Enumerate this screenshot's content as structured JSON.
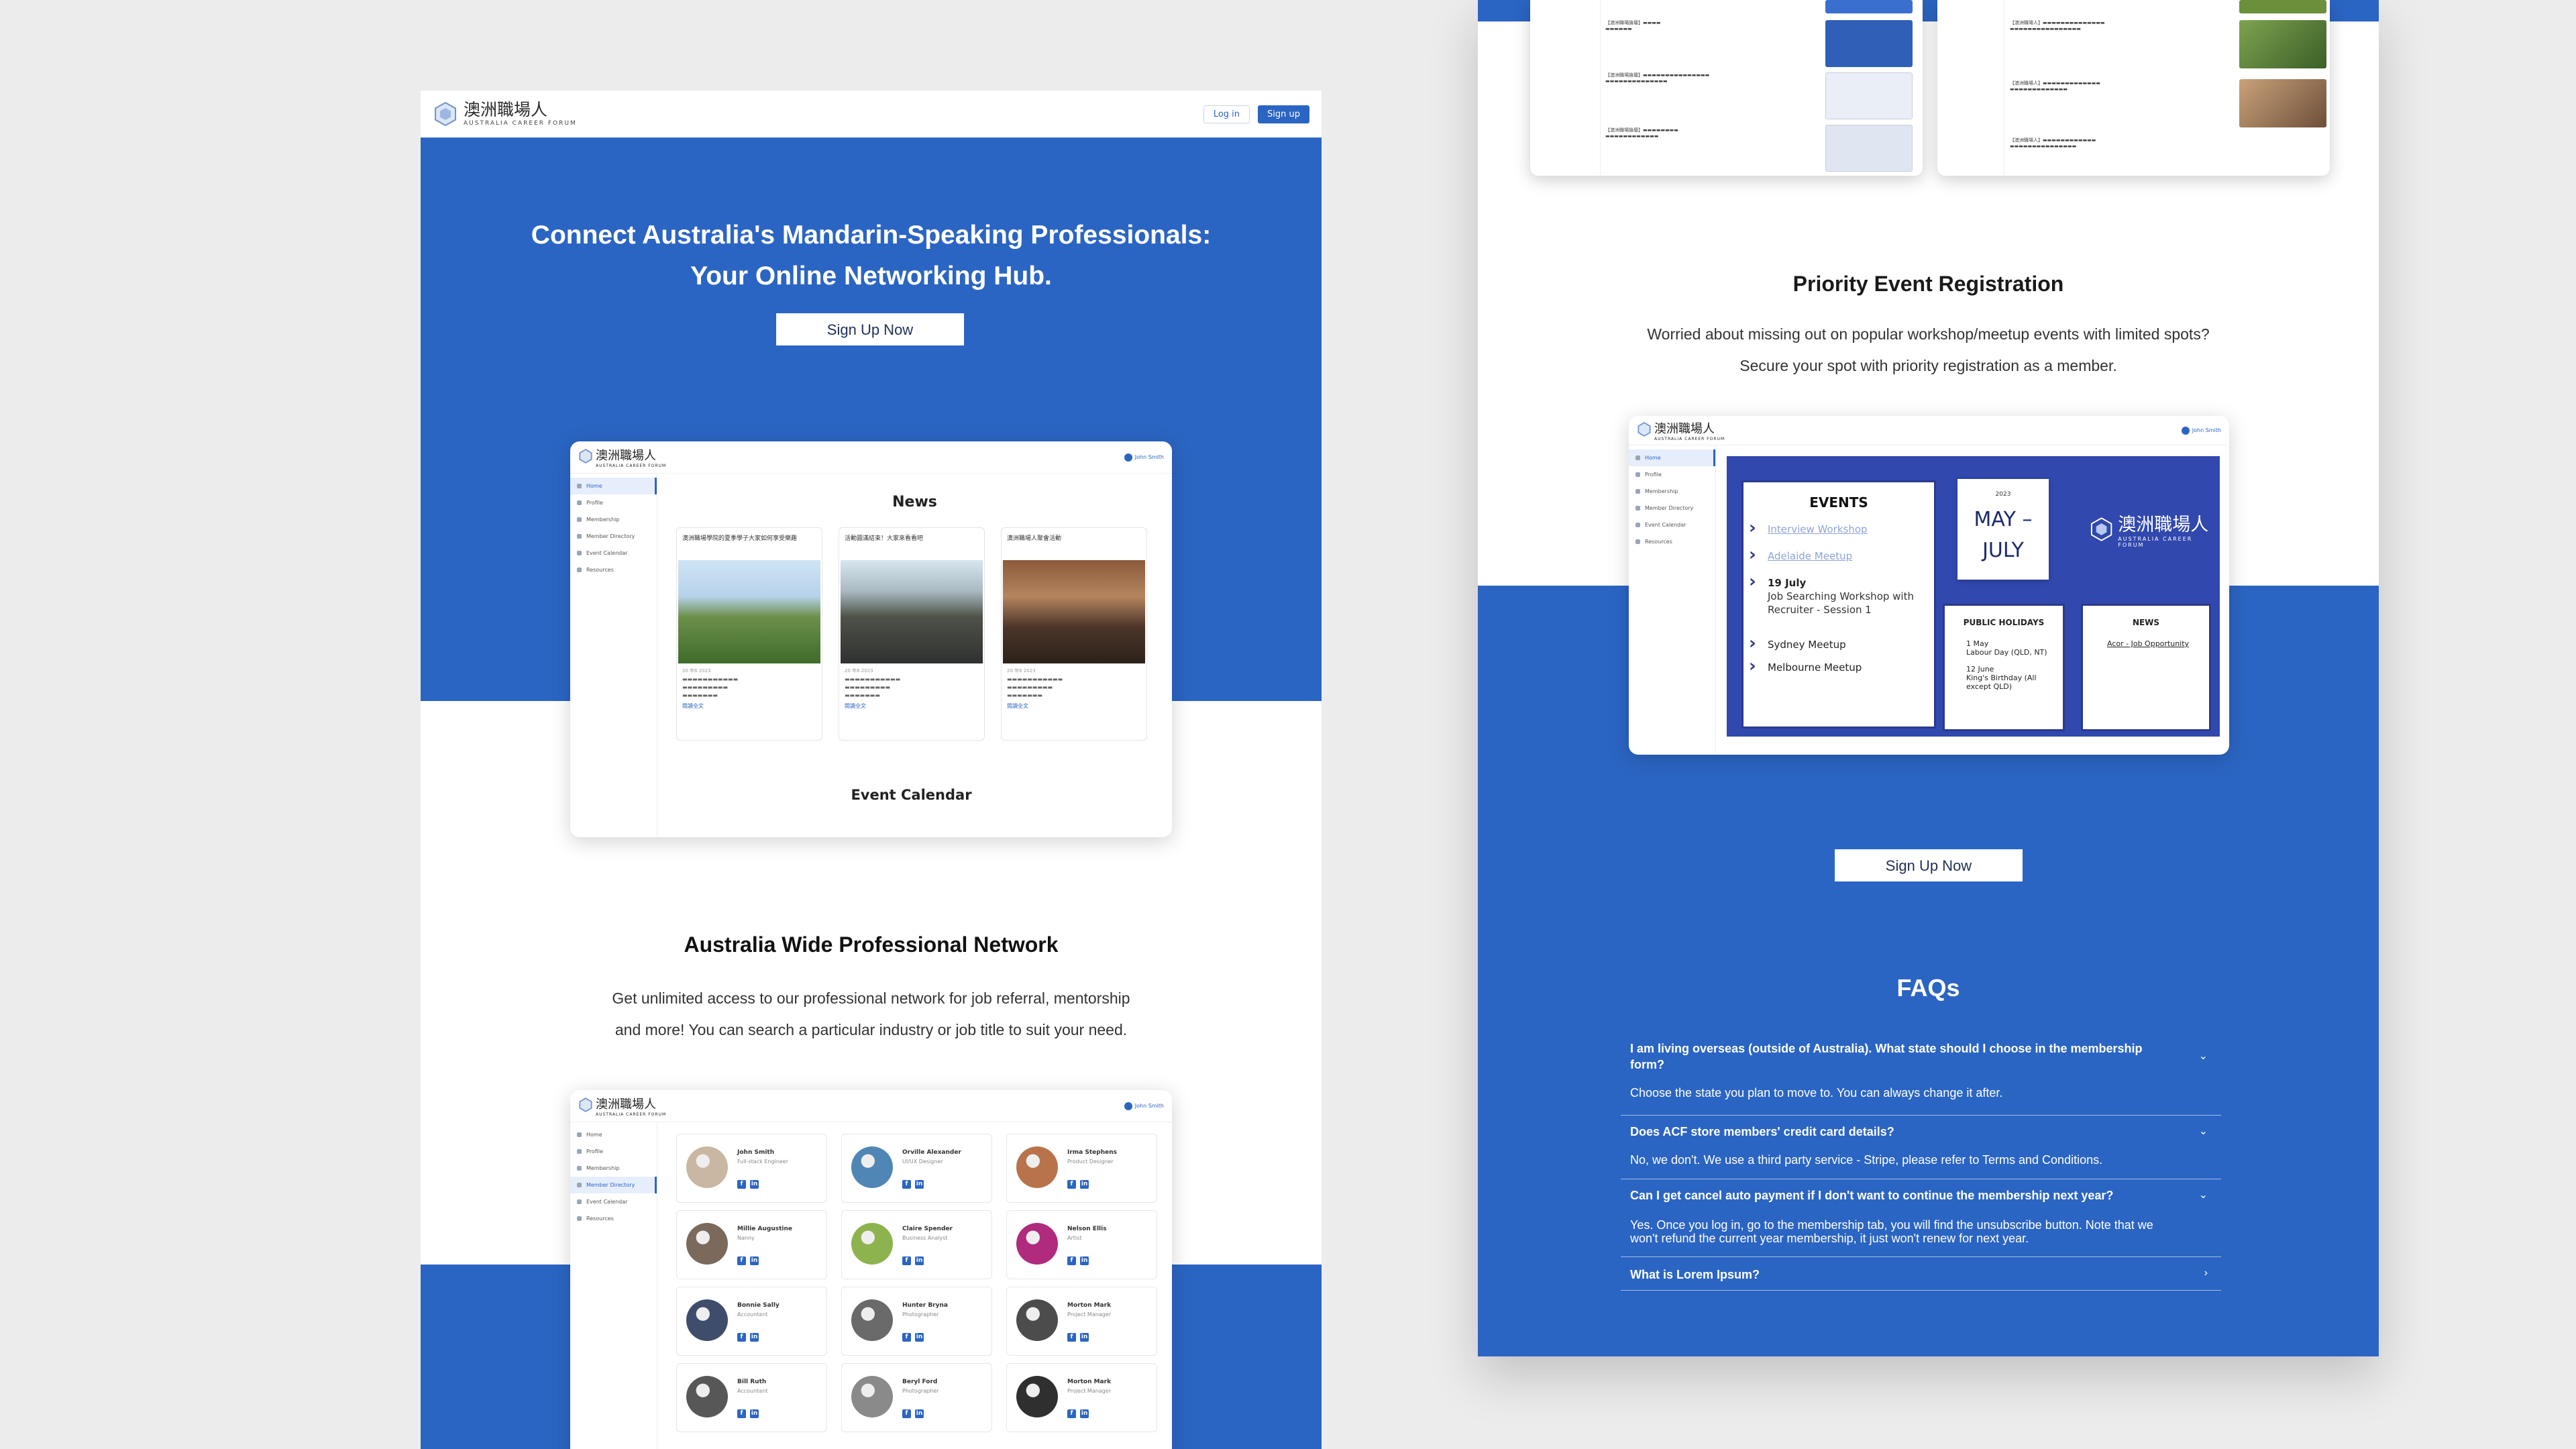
{
  "colors": {
    "brand_blue": "#2b65c3",
    "events_navy": "#3148ae",
    "background": "#ececec"
  },
  "brand": {
    "logo_cn": "澳洲職場人",
    "logo_en": "AUSTRALIA CAREER FORUM",
    "logo_icon": "hexagon-logo-icon"
  },
  "nav": {
    "login": "Log in",
    "signup": "Sign up"
  },
  "hero": {
    "line1": "Connect Australia's Mandarin-Speaking Professionals:",
    "line2": "Your Online Networking Hub.",
    "cta": "Sign Up Now"
  },
  "mock_app": {
    "user": "John Smith",
    "sidebar": [
      "Home",
      "Profile",
      "Membership",
      "Member Directory",
      "Event Calendar",
      "Resources"
    ],
    "news_heading": "News",
    "calendar_heading": "Event Calendar",
    "news": [
      {
        "title": "澳洲職場學院的夏季學子大家如何享受樂趣",
        "date": "20 年6 2023",
        "more": "閱讀全文"
      },
      {
        "title": "活動圓滿結束！大家來看看吧",
        "date": "20 年6 2023",
        "more": "閱讀全文"
      },
      {
        "title": "澳洲職場人聚會活動",
        "date": "20 年6 2023",
        "more": "閱讀全文"
      }
    ]
  },
  "network": {
    "title": "Australia Wide Professional Network",
    "text1": "Get unlimited access to our professional network for job referral, mentorship",
    "text2": "and more! You can search a particular industry or job title to suit your need.",
    "members": [
      {
        "name": "John Smith",
        "role": "Full-stack Engineer"
      },
      {
        "name": "Orville Alexander",
        "role": "UI/UX Designer"
      },
      {
        "name": "Irma Stephens",
        "role": "Product Designer"
      },
      {
        "name": "Millie Augustine",
        "role": "Nanny"
      },
      {
        "name": "Claire Spender",
        "role": "Business Analyst"
      },
      {
        "name": "Nelson Ellis",
        "role": "Artist"
      },
      {
        "name": "Bonnie Sally",
        "role": "Accountant"
      },
      {
        "name": "Hunter Bryna",
        "role": "Photographer"
      },
      {
        "name": "Morton Mark",
        "role": "Project Manager"
      },
      {
        "name": "Bill Ruth",
        "role": "Accountant"
      },
      {
        "name": "Beryl Ford",
        "role": "Photographer"
      },
      {
        "name": "Morton Mark",
        "role": "Project Manager"
      }
    ]
  },
  "priority": {
    "title": "Priority Event Registration",
    "text1": "Worried about missing out on popular workshop/meetup events with limited spots?",
    "text2": "Secure your spot with priority registration as a member.",
    "cta": "Sign Up Now"
  },
  "events_mock": {
    "events_heading": "EVENTS",
    "events": [
      {
        "label": "Interview Workshop",
        "linked": true
      },
      {
        "label": "Adelaide Meetup",
        "linked": true
      },
      {
        "label": "19 July",
        "sub": "Job Searching Workshop with Recruiter - Session 1"
      },
      {
        "label": "Sydney Meetup"
      },
      {
        "label": "Melbourne Meetup"
      }
    ],
    "date_year": "2023",
    "date_range": "MAY – JULY",
    "holidays_heading": "PUBLIC HOLIDAYS",
    "holidays": [
      {
        "date": "1 May",
        "desc": "Labour Day (QLD, NT)"
      },
      {
        "date": "12 June",
        "desc": "King's Birthday (All except QLD)"
      }
    ],
    "news_heading": "NEWS",
    "news_item": "Acor - Job Opportunity"
  },
  "faq": {
    "title": "FAQs",
    "items": [
      {
        "q": "I am living overseas (outside of Australia). What state should I choose in the membership form?",
        "a": "Choose the state you plan to move to. You can always change it after.",
        "open": true
      },
      {
        "q": "Does ACF store members' credit card details?",
        "a": "No, we don't. We use a third party service - Stripe, please refer to Terms and Conditions.",
        "open": true
      },
      {
        "q": "Can I get cancel auto payment if I don't want to continue the membership next year?",
        "a": "Yes. Once you log in, go to the membership tab, you will find the unsubscribe button. Note that we won't refund the current year membership, it just won't renew for next year.",
        "open": true
      },
      {
        "q": "What is Lorem Ipsum?",
        "a": "",
        "open": false
      }
    ]
  }
}
